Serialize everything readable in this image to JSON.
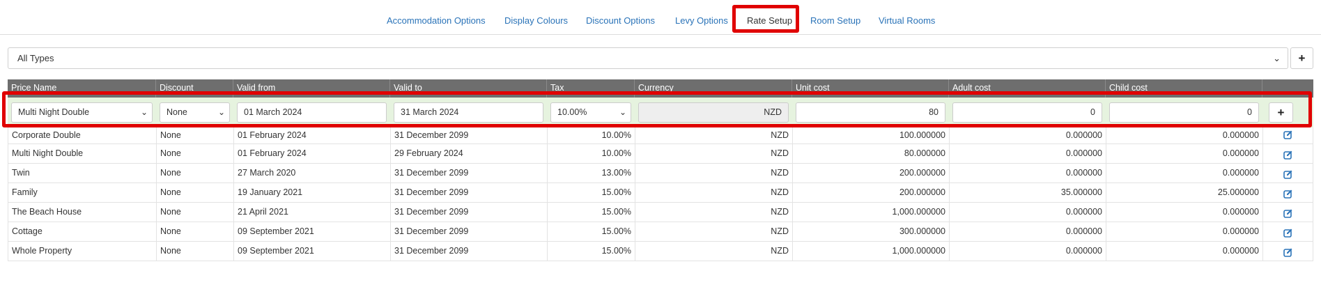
{
  "tabs": [
    {
      "label": "Accommodation Options"
    },
    {
      "label": "Display Colours"
    },
    {
      "label": "Discount Options"
    },
    {
      "label": "Levy Options"
    },
    {
      "label": "Rate Setup",
      "active": true
    },
    {
      "label": "Room Setup"
    },
    {
      "label": "Virtual Rooms"
    }
  ],
  "filter": {
    "type_value": "All Types",
    "add_icon": "plus-icon"
  },
  "table": {
    "headers": [
      "Price Name",
      "Discount",
      "Valid from",
      "Valid to",
      "Tax",
      "Currency",
      "Unit cost",
      "Adult cost",
      "Child cost",
      ""
    ],
    "new_row": {
      "price_name": "Multi Night Double",
      "discount": "None",
      "valid_from": "01 March 2024",
      "valid_to": "31 March 2024",
      "tax": "10.00%",
      "currency": "NZD",
      "unit_cost": "80",
      "adult_cost": "0",
      "child_cost": "0",
      "add_icon": "plus-icon"
    },
    "rows": [
      {
        "name": "Corporate Double",
        "discount": "None",
        "valid_from": "01 February 2024",
        "valid_to": "31 December 2099",
        "tax": "10.00%",
        "currency": "NZD",
        "unit": "100.000000",
        "adult": "0.000000",
        "child": "0.000000"
      },
      {
        "name": "Multi Night Double",
        "discount": "None",
        "valid_from": "01 February 2024",
        "valid_to": "29 February 2024",
        "tax": "10.00%",
        "currency": "NZD",
        "unit": "80.000000",
        "adult": "0.000000",
        "child": "0.000000"
      },
      {
        "name": "Twin",
        "discount": "None",
        "valid_from": "27 March 2020",
        "valid_to": "31 December 2099",
        "tax": "13.00%",
        "currency": "NZD",
        "unit": "200.000000",
        "adult": "0.000000",
        "child": "0.000000"
      },
      {
        "name": "Family",
        "discount": "None",
        "valid_from": "19 January 2021",
        "valid_to": "31 December 2099",
        "tax": "15.00%",
        "currency": "NZD",
        "unit": "200.000000",
        "adult": "35.000000",
        "child": "25.000000"
      },
      {
        "name": "The Beach House",
        "discount": "None",
        "valid_from": "21 April 2021",
        "valid_to": "31 December 2099",
        "tax": "15.00%",
        "currency": "NZD",
        "unit": "1,000.000000",
        "adult": "0.000000",
        "child": "0.000000"
      },
      {
        "name": "Cottage",
        "discount": "None",
        "valid_from": "09 September 2021",
        "valid_to": "31 December 2099",
        "tax": "15.00%",
        "currency": "NZD",
        "unit": "300.000000",
        "adult": "0.000000",
        "child": "0.000000"
      },
      {
        "name": "Whole Property",
        "discount": "None",
        "valid_from": "09 September 2021",
        "valid_to": "31 December 2099",
        "tax": "15.00%",
        "currency": "NZD",
        "unit": "1,000.000000",
        "adult": "0.000000",
        "child": "0.000000"
      }
    ]
  },
  "colors": {
    "link": "#2a73b8",
    "highlight": "#e00000",
    "header_bg": "#6e6e6e",
    "new_row_bg": "#e6f3df"
  }
}
